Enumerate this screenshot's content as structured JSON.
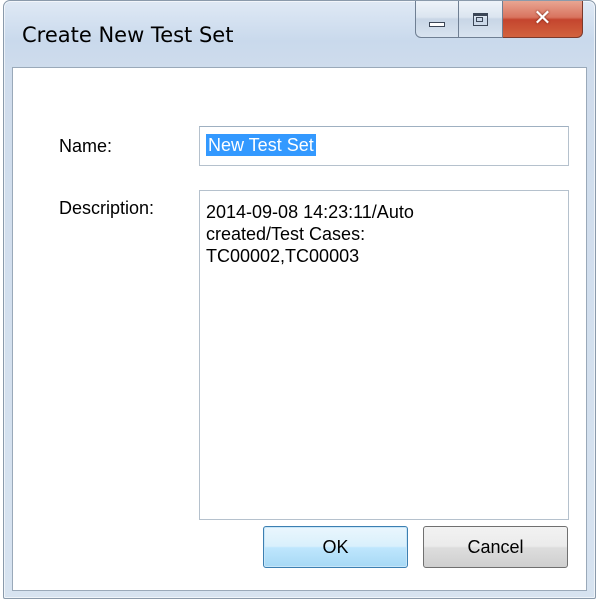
{
  "window": {
    "title": "Create New Test Set"
  },
  "caption_buttons": {
    "minimize": "minimize-icon",
    "maximize": "maximize-icon",
    "close": "close-icon",
    "close_glyph": "✕"
  },
  "form": {
    "name_label": "Name:",
    "name_value": "New Test Set",
    "description_label": "Description:",
    "description_value": "2014-09-08 14:23:11/Auto\ncreated/Test Cases:\nTC00002,TC00003"
  },
  "buttons": {
    "ok_label": "OK",
    "cancel_label": "Cancel"
  },
  "colors": {
    "selection": "#3399ff",
    "close_button": "#c4452e",
    "ok_button_border": "#3c7fb1"
  }
}
